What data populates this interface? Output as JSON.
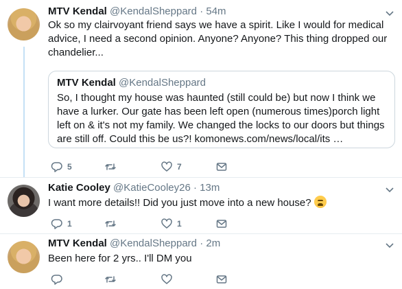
{
  "tweets": [
    {
      "name": "MTV Kendal",
      "handle": "@KendalSheppard",
      "dot": "·",
      "time": "54m",
      "avatar_icon": "avatar-kendal",
      "text": "Ok so my clairvoyant friend says we have a spirit. Like I would for medical advice, I need a second opinion. Anyone? Anyone? This thing dropped our chandelier...",
      "quote": {
        "name": "MTV Kendal",
        "handle": "@KendalSheppard",
        "text": "So, I thought my house was haunted (still could be) but now I think we have a lurker. Our gate has been left open (numerous times)porch light left on & it's not my family. We changed the locks to our doors but things are still off. Could this be us?! komonews.com/news/local/its …"
      },
      "reply_count": "5",
      "retweet_count": "",
      "like_count": "7"
    },
    {
      "name": "Katie Cooley",
      "handle": "@KatieCooley26",
      "dot": "·",
      "time": "13m",
      "avatar_icon": "avatar-katie",
      "text": "I want more details!! Did you just move into a new house?",
      "emoji": "tired-face-emoji",
      "reply_count": "1",
      "retweet_count": "",
      "like_count": "1"
    },
    {
      "name": "MTV Kendal",
      "handle": "@KendalSheppard",
      "dot": "·",
      "time": "2m",
      "avatar_icon": "avatar-kendal",
      "text": "Been here for 2 yrs.. I'll DM you",
      "reply_count": "",
      "retweet_count": "",
      "like_count": ""
    }
  ],
  "colors": {
    "text": "#14171a",
    "secondary": "#657786",
    "thread_line": "#c4e0f5",
    "border": "#e6ecf0"
  }
}
